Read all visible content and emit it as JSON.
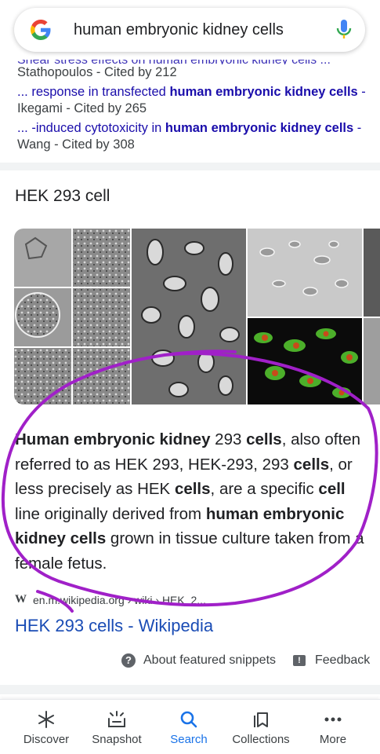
{
  "search": {
    "query": "human embryonic kidney cells",
    "logo_letter": "G"
  },
  "cited_results": {
    "cut_line": "Shear stress effects on human embryonic kidney cells ...",
    "items": [
      {
        "link_prefix": "... response in transfected ",
        "link_bold": "human embryonic kidney cells",
        "link_suffix": " -",
        "byline": "Ikegami - Cited by 265"
      },
      {
        "link_prefix": "... -induced cytotoxicity in ",
        "link_bold": "human embryonic kidney cells",
        "link_suffix": " -",
        "byline": "Wang - Cited by 308"
      }
    ],
    "first_byline": "Stathopoulos - Cited by 212"
  },
  "featured": {
    "title": "HEK 293 cell",
    "snippet": {
      "p1_b": "Human embryonic kidney",
      "p1": " 293 ",
      "p2_b": "cells",
      "p3": ", also often referred to as HEK 293, HEK-293, 293 ",
      "p4_b": "cells",
      "p5": ", or less precisely as HEK ",
      "p6_b": "cells",
      "p7": ", are a specific ",
      "p8_b": "cell",
      "p9": " line originally derived from ",
      "p10_b": "human embryonic kidney cells",
      "p11": " grown in tissue culture taken from a female fetus."
    },
    "source_url": "en.m.wikipedia.org › wiki › HEK_2...",
    "source_icon": "W",
    "link_title": "HEK 293 cells - Wikipedia",
    "about_label": "About featured snippets",
    "feedback_label": "Feedback"
  },
  "bottom_nav": {
    "items": [
      {
        "label": "Discover",
        "icon": "asterisk-icon"
      },
      {
        "label": "Snapshot",
        "icon": "snapshot-icon"
      },
      {
        "label": "Search",
        "icon": "search-icon",
        "active": true
      },
      {
        "label": "Collections",
        "icon": "bookmark-icon"
      },
      {
        "label": "More",
        "icon": "more-dots-icon"
      }
    ]
  },
  "colors": {
    "link_blue": "#1a0dab",
    "title_blue": "#1a4cb5",
    "active_blue": "#1a73e8",
    "annotation_purple": "#a020c8"
  }
}
